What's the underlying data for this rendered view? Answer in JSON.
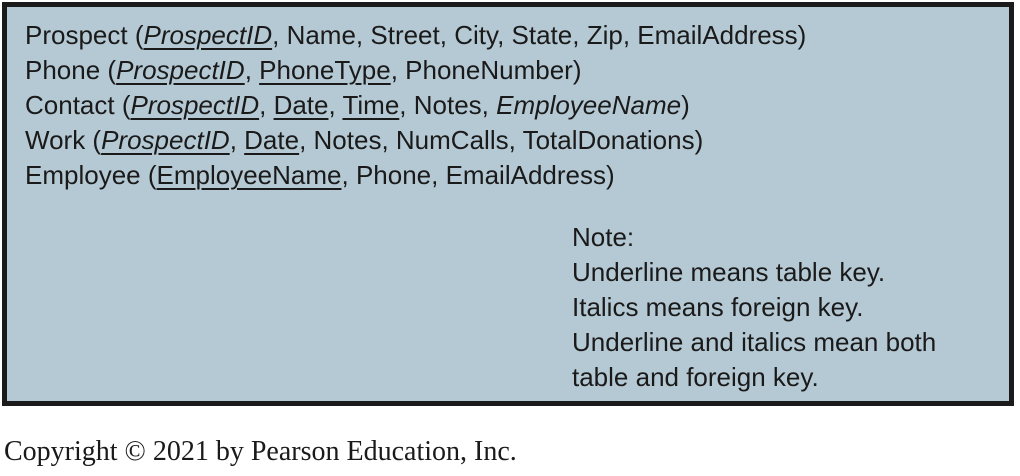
{
  "relations": [
    {
      "table": "Prospect",
      "attributes": [
        {
          "name": "ProspectID",
          "key": true,
          "foreign": true
        },
        {
          "name": "Name",
          "key": false,
          "foreign": false
        },
        {
          "name": "Street",
          "key": false,
          "foreign": false
        },
        {
          "name": "City",
          "key": false,
          "foreign": false
        },
        {
          "name": "State",
          "key": false,
          "foreign": false
        },
        {
          "name": "Zip",
          "key": false,
          "foreign": false
        },
        {
          "name": "EmailAddress",
          "key": false,
          "foreign": false
        }
      ]
    },
    {
      "table": "Phone",
      "attributes": [
        {
          "name": "ProspectID",
          "key": true,
          "foreign": true
        },
        {
          "name": "PhoneType",
          "key": true,
          "foreign": false
        },
        {
          "name": "PhoneNumber",
          "key": false,
          "foreign": false
        }
      ]
    },
    {
      "table": "Contact",
      "attributes": [
        {
          "name": "ProspectID",
          "key": true,
          "foreign": true
        },
        {
          "name": "Date",
          "key": true,
          "foreign": false
        },
        {
          "name": "Time",
          "key": true,
          "foreign": false
        },
        {
          "name": "Notes",
          "key": false,
          "foreign": false
        },
        {
          "name": "EmployeeName",
          "key": false,
          "foreign": true
        }
      ]
    },
    {
      "table": "Work",
      "attributes": [
        {
          "name": "ProspectID",
          "key": true,
          "foreign": true
        },
        {
          "name": "Date",
          "key": true,
          "foreign": false
        },
        {
          "name": "Notes",
          "key": false,
          "foreign": false
        },
        {
          "name": "NumCalls",
          "key": false,
          "foreign": false
        },
        {
          "name": "TotalDonations",
          "key": false,
          "foreign": false
        }
      ]
    },
    {
      "table": "Employee",
      "attributes": [
        {
          "name": "EmployeeName",
          "key": true,
          "foreign": false
        },
        {
          "name": "Phone",
          "key": false,
          "foreign": false
        },
        {
          "name": "EmailAddress",
          "key": false,
          "foreign": false
        }
      ]
    }
  ],
  "note": {
    "heading": "Note:",
    "lines": [
      "Underline means table key.",
      "Italics means foreign key.",
      "Underline and italics mean both",
      "table and foreign key."
    ]
  },
  "copyright": "Copyright © 2021 by Pearson Education, Inc.",
  "colors": {
    "box_background": "#b5c9d4",
    "box_border": "#1b1b1b",
    "text": "#1a1a1a"
  }
}
